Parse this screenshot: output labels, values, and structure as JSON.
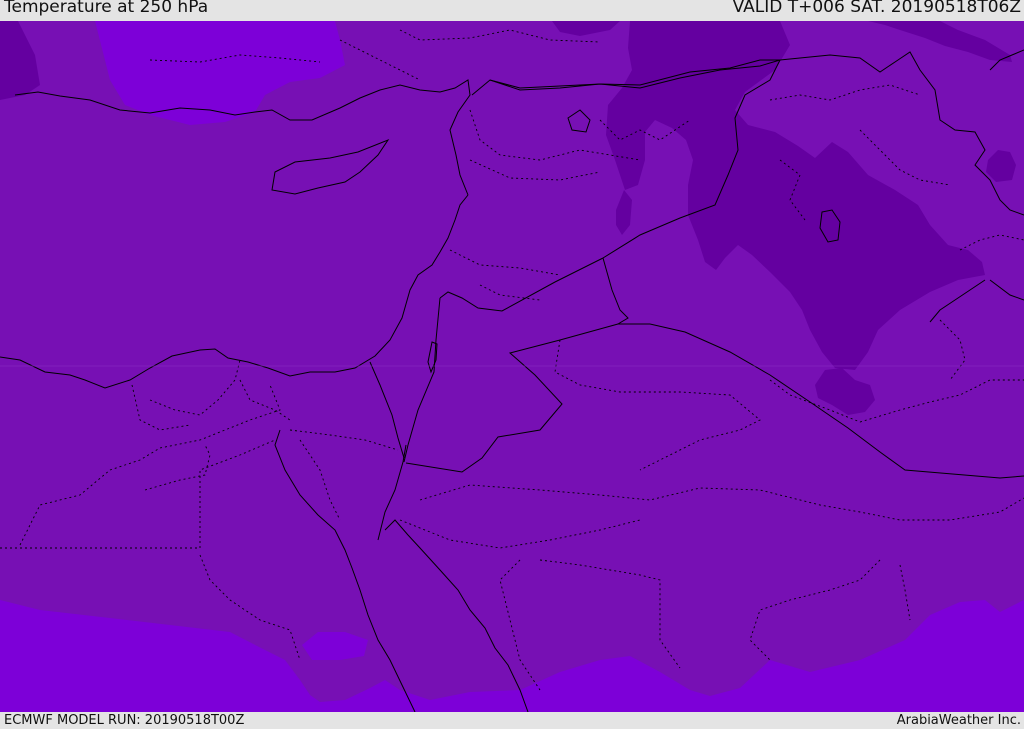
{
  "header": {
    "title": "Temperature at 250 hPa",
    "valid_time": "VALID T+006 SAT. 20190518T06Z"
  },
  "footer": {
    "model_run": "ECMWF MODEL RUN: 20190518T00Z",
    "credit": "ArabiaWeather Inc."
  },
  "map": {
    "variable": "temperature",
    "level": "250 hPa",
    "colors": {
      "base_fill": "#7710b4",
      "cold_fill": "#6400a0",
      "warm_fill": "#7d00d8",
      "boundary_line": "#000000"
    },
    "features": [
      "coastlines",
      "national-borders",
      "regional-borders"
    ]
  }
}
